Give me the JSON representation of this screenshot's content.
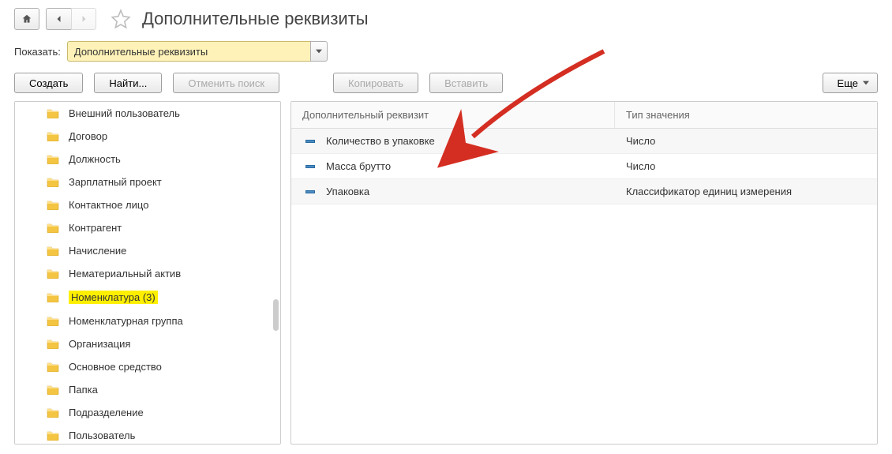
{
  "title": "Дополнительные реквизиты",
  "filter": {
    "label": "Показать:",
    "value": "Дополнительные реквизиты"
  },
  "toolbar": {
    "create": "Создать",
    "find": "Найти...",
    "cancel_search": "Отменить поиск",
    "copy": "Копировать",
    "paste": "Вставить",
    "more": "Еще"
  },
  "tree": {
    "items": [
      {
        "label": "Внешний пользователь",
        "highlighted": false
      },
      {
        "label": "Договор",
        "highlighted": false
      },
      {
        "label": "Должность",
        "highlighted": false
      },
      {
        "label": "Зарплатный проект",
        "highlighted": false
      },
      {
        "label": "Контактное лицо",
        "highlighted": false
      },
      {
        "label": "Контрагент",
        "highlighted": false
      },
      {
        "label": "Начисление",
        "highlighted": false
      },
      {
        "label": "Нематериальный актив",
        "highlighted": false
      },
      {
        "label": "Номенклатура (3)",
        "highlighted": true
      },
      {
        "label": "Номенклатурная группа",
        "highlighted": false
      },
      {
        "label": "Организация",
        "highlighted": false
      },
      {
        "label": "Основное средство",
        "highlighted": false
      },
      {
        "label": "Папка",
        "highlighted": false
      },
      {
        "label": "Подразделение",
        "highlighted": false
      },
      {
        "label": "Пользователь",
        "highlighted": false
      }
    ]
  },
  "table": {
    "col_name": "Дополнительный реквизит",
    "col_type": "Тип значения",
    "rows": [
      {
        "name": "Количество в упаковке",
        "type": "Число"
      },
      {
        "name": "Масса брутто",
        "type": "Число"
      },
      {
        "name": "Упаковка",
        "type": "Классификатор единиц измерения"
      }
    ]
  }
}
